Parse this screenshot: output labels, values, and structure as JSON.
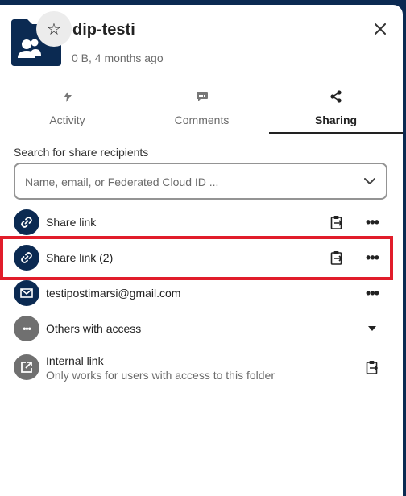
{
  "header": {
    "title": "dip-testi",
    "subtitle": "0 B, 4 months ago"
  },
  "tabs": [
    {
      "label": "Activity",
      "icon": "activity-icon",
      "active": false
    },
    {
      "label": "Comments",
      "icon": "comments-icon",
      "active": false
    },
    {
      "label": "Sharing",
      "icon": "share-icon",
      "active": true
    }
  ],
  "search": {
    "label": "Search for share recipients",
    "placeholder": "Name, email, or Federated Cloud ID ..."
  },
  "shares": [
    {
      "label": "Share link",
      "icon": "link-icon"
    },
    {
      "label": "Share link (2)",
      "icon": "link-icon",
      "highlighted": true
    },
    {
      "label": "testipostimarsi@gmail.com",
      "icon": "email-icon"
    },
    {
      "label": "Others with access",
      "icon": "more-horizontal-icon"
    },
    {
      "label": "Internal link",
      "sublabel": "Only works for users with access to this folder",
      "icon": "external-link-icon"
    }
  ],
  "colors": {
    "navy": "#0b2a52",
    "highlight": "#e11d2a",
    "muted_text": "#6b6b6b"
  }
}
